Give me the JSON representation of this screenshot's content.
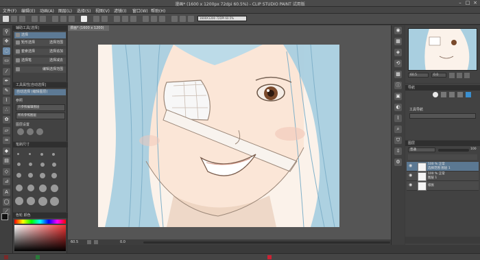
{
  "window": {
    "title": "漫画* (1600 x 1200px 72dpi 60.5%) - CLIP STUDIO PAINT 试用版",
    "controls": [
      "minimize-icon",
      "maximize-icon",
      "close-icon"
    ]
  },
  "menu": [
    "文件(F)",
    "编辑(E)",
    "动画(A)",
    "图层(L)",
    "选择(S)",
    "视图(V)",
    "滤镜(I)",
    "窗口(W)",
    "帮助(H)"
  ],
  "command_bar": {
    "field_text": "1600X1200 72DPI 60.5%"
  },
  "tools": [
    "zoom-icon",
    "move-icon",
    "lasso-icon",
    "select-icon",
    "eyedropper-icon",
    "pen-icon",
    "pencil-icon",
    "brush-icon",
    "airbrush-icon",
    "decoration-icon",
    "eraser-icon",
    "blend-icon",
    "fill-icon",
    "gradient-icon",
    "figure-icon",
    "ruler-icon",
    "text-icon",
    "balloon-icon",
    "correction-icon"
  ],
  "subtool": {
    "header": "辅助工具[选择]",
    "active_tab": "选择",
    "items": [
      {
        "label": "矩形选择",
        "right": "选择范围"
      },
      {
        "label": "套索选择",
        "right": "选择追加"
      },
      {
        "label": "选择笔",
        "right": "选择减去"
      },
      {
        "label": "",
        "right": "编辑选择范围"
      }
    ]
  },
  "tool_property": {
    "header": "工具属性[自动选择]",
    "tool_name": "自动选择 (编辑图层)",
    "mode_label": "参照",
    "value1": "只参照编辑图层",
    "value2": "所有参照图层",
    "section": "图层设置"
  },
  "brush_size": {
    "header": "笔刷尺寸"
  },
  "color_panel": {
    "header": "色轮 颜色"
  },
  "document": {
    "tab": "漫画* (1600 x 1200)"
  },
  "canvas_status": {
    "zoom": "60.5",
    "angle": "0.0"
  },
  "navigator": {
    "zoom": "60.5",
    "rotation": "0.0"
  },
  "subview": {
    "title": "导航",
    "item": "工具导航"
  },
  "layers": {
    "header": "图层",
    "blend_mode": "普通",
    "opacity": "100",
    "items": [
      {
        "name": "100 % 正常",
        "sub": "选择范围 图层 1",
        "selected": true
      },
      {
        "name": "100 % 正常",
        "sub": "图层 1",
        "selected": false
      },
      {
        "name": "纸张",
        "sub": "",
        "selected": false
      }
    ]
  },
  "colors": {
    "accent": "#5b7892",
    "selection": "#6d8ba8",
    "hair": "#a9cfe0",
    "skin": "#fbe9dc"
  }
}
